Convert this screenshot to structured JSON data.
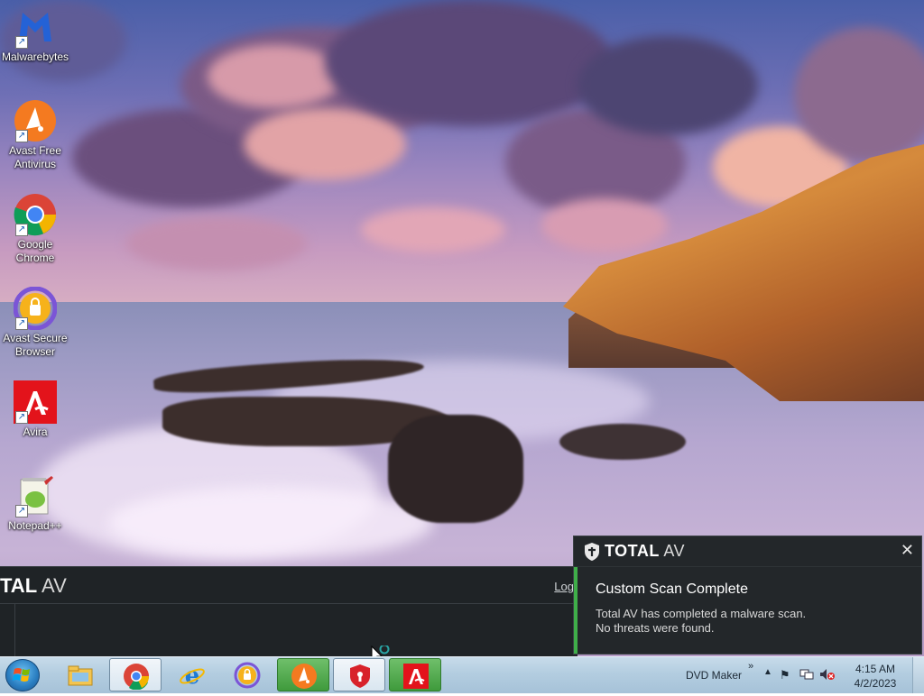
{
  "desktop": {
    "icons": [
      {
        "label": "Malwarebytes"
      },
      {
        "label": "Avast Free Antivirus"
      },
      {
        "label": "Google Chrome"
      },
      {
        "label": "Avast Secure Browser"
      },
      {
        "label": "Avira"
      },
      {
        "label": "Notepad++"
      }
    ]
  },
  "totalav_window": {
    "brand_bold": "TAL",
    "brand_light": " AV",
    "login_label": "Log"
  },
  "toast": {
    "brand_bold": "TOTAL",
    "brand_light": " AV",
    "close_label": "✕",
    "title": "Custom Scan Complete",
    "message_line1": "Total AV has completed a malware scan.",
    "message_line2": "No threats were found.",
    "accent_color": "#3fae49"
  },
  "taskbar": {
    "apps": [
      {
        "name": "file-explorer-icon"
      },
      {
        "name": "chrome-icon"
      },
      {
        "name": "internet-explorer-icon"
      },
      {
        "name": "avast-secure-browser-icon"
      },
      {
        "name": "avast-icon"
      },
      {
        "name": "totalav-icon"
      },
      {
        "name": "avira-icon"
      }
    ],
    "tray": {
      "toolbar_label": "DVD Maker",
      "toolbar_chevron": "»",
      "time": "4:15 AM",
      "date": "4/2/2023"
    }
  }
}
